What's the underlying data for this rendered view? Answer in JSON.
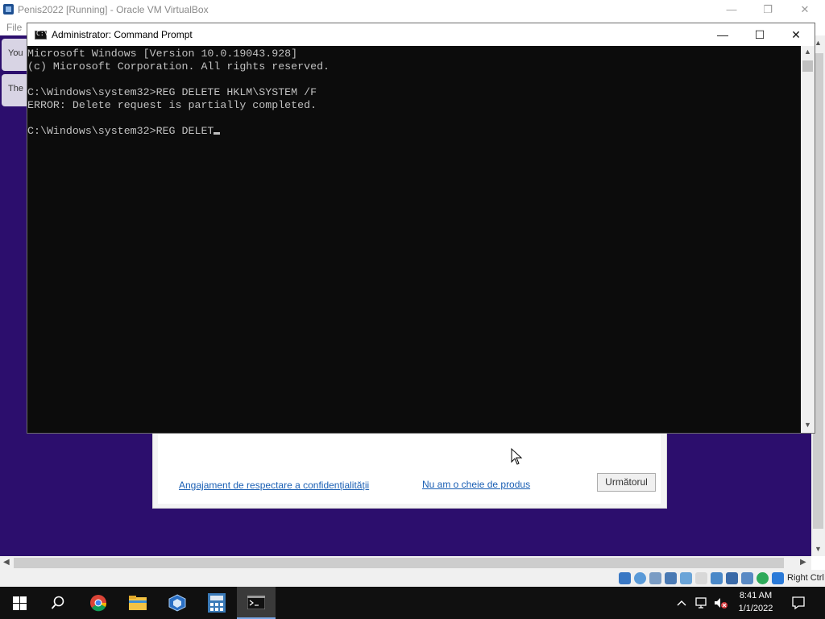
{
  "vbox": {
    "title": "Penis2022 [Running] - Oracle VM VirtualBox",
    "menu_file": "File",
    "right_ctrl": "Right Ctrl"
  },
  "guest": {
    "side_tab_1": "You",
    "side_tab_2": "The",
    "setup": {
      "privacy_link": "Angajament de respectare a confidențialității",
      "no_key_link": "Nu am o cheie de produs",
      "next_button": "Următorul"
    }
  },
  "cmd": {
    "title": "Administrator: Command Prompt",
    "lines": [
      "Microsoft Windows [Version 10.0.19043.928]",
      "(c) Microsoft Corporation. All rights reserved.",
      "",
      "C:\\Windows\\system32>REG DELETE HKLM\\SYSTEM /F",
      "ERROR: Delete request is partially completed.",
      "",
      "C:\\Windows\\system32>REG DELET"
    ]
  },
  "taskbar": {
    "time": "8:41 AM",
    "date": "1/1/2022"
  },
  "colors": {
    "guest_background": "#2c0e6d",
    "cmd_background": "#0c0c0c",
    "cmd_text": "#c0c0c0",
    "link": "#1a5fb4",
    "taskbar": "#101010"
  },
  "icons": [
    "virtualbox-icon",
    "cmd-icon",
    "windows-start-icon",
    "search-icon",
    "chrome-icon",
    "file-explorer-icon",
    "virtualbox-taskbar-icon",
    "calculator-taskbar-icon",
    "cmd-taskbar-icon",
    "chevron-up-icon",
    "network-icon",
    "volume-muted-icon",
    "notification-icon"
  ]
}
